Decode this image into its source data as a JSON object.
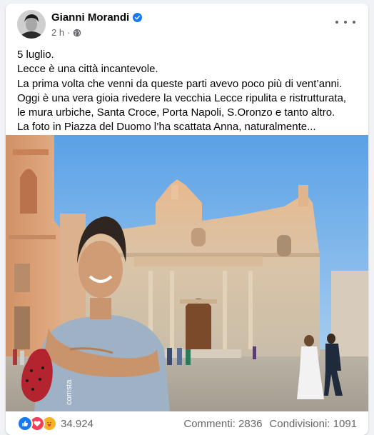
{
  "post": {
    "author": "Gianni Morandi",
    "time": "2 h",
    "separator": "·",
    "lines": [
      "5 luglio.",
      "Lecce è una città incantevole.",
      "La prima volta che venni da queste parti avevo poco più di vent’anni.",
      "Oggi è una vera gioia rivedere la vecchia Lecce ripulita e ristrutturata,",
      "le mura urbiche, Santa Croce, Porta Napoli, S.Oronzo e tanto altro.",
      "La foto in Piazza del Duomo l’ha scattata Anna, naturalmente..."
    ]
  },
  "photo": {
    "tshirt_text": "comsta"
  },
  "footer": {
    "reactions_count": "34.924",
    "comments": "Commenti: 2836",
    "shares": "Condivisioni: 1091"
  },
  "colors": {
    "like": "#1877f2",
    "love": "#f33e58",
    "care": "#f7b125",
    "verified": "#1877f2"
  },
  "icons": [
    "verified-badge-icon",
    "globe-icon",
    "more-options-icon",
    "like-reaction-icon",
    "love-reaction-icon",
    "care-reaction-icon"
  ]
}
